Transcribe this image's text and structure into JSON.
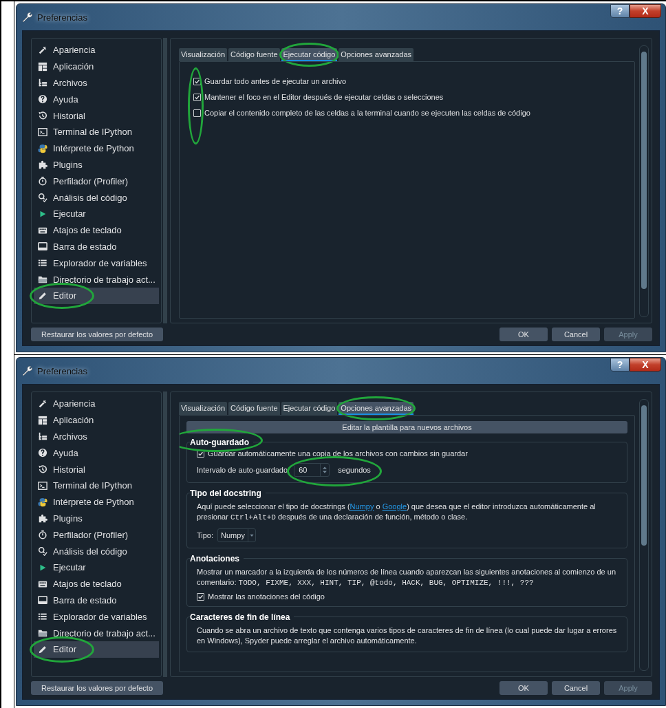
{
  "windows": [
    {
      "title": "Preferencias",
      "help_button": "?",
      "close_button": "X",
      "sidebar": {
        "items": [
          {
            "label": "Apariencia",
            "selected": false,
            "circled": false
          },
          {
            "label": "Aplicación",
            "selected": false,
            "circled": false
          },
          {
            "label": "Archivos",
            "selected": false,
            "circled": false
          },
          {
            "label": "Ayuda",
            "selected": false,
            "circled": false
          },
          {
            "label": "Historial",
            "selected": false,
            "circled": false
          },
          {
            "label": "Terminal de IPython",
            "selected": false,
            "circled": false
          },
          {
            "label": "Intérprete de Python",
            "selected": false,
            "circled": false
          },
          {
            "label": "Plugins",
            "selected": false,
            "circled": false
          },
          {
            "label": "Perfilador (Profiler)",
            "selected": false,
            "circled": false
          },
          {
            "label": "Análisis del código",
            "selected": false,
            "circled": false
          },
          {
            "label": "Ejecutar",
            "selected": false,
            "circled": false
          },
          {
            "label": "Atajos de teclado",
            "selected": false,
            "circled": false
          },
          {
            "label": "Barra de estado",
            "selected": false,
            "circled": false
          },
          {
            "label": "Explorador de variables",
            "selected": false,
            "circled": false
          },
          {
            "label": "Directorio de trabajo act...",
            "selected": false,
            "circled": false
          },
          {
            "label": "Editor",
            "selected": true,
            "circled": true
          }
        ]
      },
      "tabs": [
        {
          "label": "Visualización",
          "selected": false,
          "circled": false
        },
        {
          "label": "Código fuente",
          "selected": false,
          "circled": false
        },
        {
          "label": "Ejecutar código",
          "selected": true,
          "circled": true
        },
        {
          "label": "Opciones avanzadas",
          "selected": false,
          "circled": false
        }
      ],
      "page": {
        "kind": "checklist",
        "checks_circled": true,
        "options": [
          {
            "label": "Guardar todo antes de ejecutar un archivo",
            "checked": true
          },
          {
            "label": "Mantener el foco en el Editor después de ejecutar celdas o selecciones",
            "checked": true
          },
          {
            "label": "Copiar el contenido completo de las celdas a la terminal cuando se ejecuten las celdas de código",
            "checked": false
          }
        ]
      },
      "buttons": {
        "reset": "Restaurar los valores por defecto",
        "ok": "OK",
        "cancel": "Cancel",
        "apply": {
          "label": "Apply",
          "disabled": true
        }
      }
    },
    {
      "title": "Preferencias",
      "help_button": "?",
      "close_button": "X",
      "sidebar": {
        "items": [
          {
            "label": "Apariencia",
            "selected": false,
            "circled": false
          },
          {
            "label": "Aplicación",
            "selected": false,
            "circled": false
          },
          {
            "label": "Archivos",
            "selected": false,
            "circled": false
          },
          {
            "label": "Ayuda",
            "selected": false,
            "circled": false
          },
          {
            "label": "Historial",
            "selected": false,
            "circled": false
          },
          {
            "label": "Terminal de IPython",
            "selected": false,
            "circled": false
          },
          {
            "label": "Intérprete de Python",
            "selected": false,
            "circled": false
          },
          {
            "label": "Plugins",
            "selected": false,
            "circled": false
          },
          {
            "label": "Perfilador (Profiler)",
            "selected": false,
            "circled": false
          },
          {
            "label": "Análisis del código",
            "selected": false,
            "circled": false
          },
          {
            "label": "Ejecutar",
            "selected": false,
            "circled": false
          },
          {
            "label": "Atajos de teclado",
            "selected": false,
            "circled": false
          },
          {
            "label": "Barra de estado",
            "selected": false,
            "circled": false
          },
          {
            "label": "Explorador de variables",
            "selected": false,
            "circled": false
          },
          {
            "label": "Directorio de trabajo act...",
            "selected": false,
            "circled": false
          },
          {
            "label": "Editor",
            "selected": true,
            "circled": true
          }
        ]
      },
      "tabs": [
        {
          "label": "Visualización",
          "selected": false,
          "circled": false
        },
        {
          "label": "Código fuente",
          "selected": false,
          "circled": false
        },
        {
          "label": "Ejecutar código",
          "selected": false,
          "circled": false
        },
        {
          "label": "Opciones avanzadas",
          "selected": true,
          "circled": true
        }
      ],
      "page": {
        "kind": "advanced",
        "template_button": "Editar la plantilla para nuevos archivos",
        "groups": [
          {
            "title": "Auto-guardado",
            "circled": true,
            "rows": [
              {
                "kind": "checkbox",
                "label": "Guardar automáticamente una copia de los archivos con cambios sin guardar",
                "checked": true
              },
              {
                "kind": "spin",
                "label": "Intervalo de auto-guardado:",
                "value": "60",
                "unit": "segundos",
                "circled": true
              }
            ]
          },
          {
            "title": "Tipo del docstring",
            "circled": false,
            "rows": [
              {
                "kind": "paragraph",
                "parts": [
                  {
                    "kind": "text",
                    "text": "Aquí puede seleccionar el tipo de docstrings ("
                  },
                  {
                    "kind": "link",
                    "text": "Numpy"
                  },
                  {
                    "kind": "text",
                    "text": " o "
                  },
                  {
                    "kind": "link",
                    "text": "Google"
                  },
                  {
                    "kind": "text",
                    "text": ") que desea que el editor introduzca automáticamente al presionar "
                  },
                  {
                    "kind": "code",
                    "text": "Ctrl+Alt+D"
                  },
                  {
                    "kind": "text",
                    "text": " después de una declaración de función, método o clase."
                  }
                ]
              },
              {
                "kind": "combo",
                "label": "Tipo:",
                "value": "Numpy"
              }
            ]
          },
          {
            "title": "Anotaciones",
            "circled": false,
            "rows": [
              {
                "kind": "paragraph",
                "parts": [
                  {
                    "kind": "text",
                    "text": "Mostrar un marcador a la izquierda de los números de línea cuando aparezcan las siguientes anotaciones al comienzo de un comentario: "
                  },
                  {
                    "kind": "code",
                    "text": "TODO, FIXME, XXX, HINT, TIP, @todo, HACK, BUG, OPTIMIZE, !!!, ???"
                  }
                ]
              },
              {
                "kind": "checkbox",
                "label": "Mostrar las anotaciones del código",
                "checked": true
              }
            ]
          },
          {
            "title": "Caracteres de fin de línea",
            "circled": false,
            "rows": [
              {
                "kind": "paragraph",
                "parts": [
                  {
                    "kind": "text",
                    "text": "Cuando se abra un archivo de texto que contenga varios tipos de caracteres de fin de línea (lo cual puede dar lugar a errores en Windows), Spyder puede arreglar el archivo automáticamente."
                  }
                ]
              }
            ]
          }
        ]
      },
      "buttons": {
        "reset": "Restaurar los valores por defecto",
        "ok": "OK",
        "cancel": "Cancel",
        "apply": {
          "label": "Apply",
          "disabled": true
        }
      }
    }
  ]
}
